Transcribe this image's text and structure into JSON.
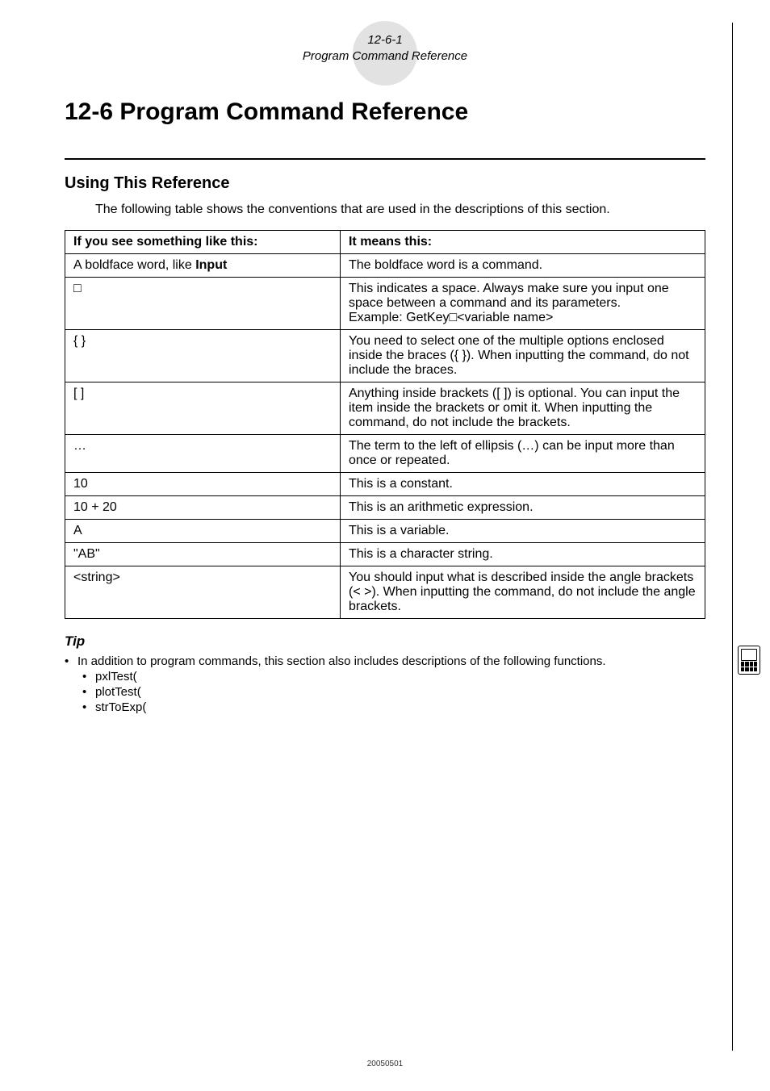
{
  "header": {
    "section_num": "12-6-1",
    "section_title": "Program Command Reference"
  },
  "title": "12-6  Program Command Reference",
  "subtitle": "Using This Reference",
  "intro": "The following table shows the conventions that are used in the descriptions of this section.",
  "table": {
    "head_left": "If you see something like this:",
    "head_right": "It means this:",
    "rows": [
      {
        "left_html": "A boldface word, like <b>Input</b>",
        "right": "The boldface word is a command."
      },
      {
        "left_html": "&#x25A1;",
        "right": "This indicates a space. Always make sure you input one space between a command and its parameters.\nExample: GetKey□<variable name>"
      },
      {
        "left_html": "{  }",
        "right": "You need to select one of the multiple options enclosed inside the braces ({ }). When inputting the command, do not include the braces."
      },
      {
        "left_html": "[   ]",
        "right": "Anything inside brackets ([ ]) is optional. You can input the item inside the brackets or omit it. When inputting the command, do not include the brackets."
      },
      {
        "left_html": "…",
        "right": "The term to the left of ellipsis (…) can be input more than once or repeated."
      },
      {
        "left_html": "10",
        "right": "This is a constant."
      },
      {
        "left_html": "10 + 20",
        "right": "This is an arithmetic expression."
      },
      {
        "left_html": "A",
        "right": "This is a variable."
      },
      {
        "left_html": "\"AB\"",
        "right": "This is a character string."
      },
      {
        "left_html": "&lt;string&gt;",
        "right": "You should input what is described inside the angle brackets (< >). When inputting the command, do not include the angle brackets."
      }
    ]
  },
  "tip": {
    "label": "Tip",
    "lead": "In addition to program commands, this section also includes descriptions of the following functions.",
    "items": [
      "pxlTest(",
      "plotTest(",
      "strToExp("
    ]
  },
  "footer_num": "20050501"
}
